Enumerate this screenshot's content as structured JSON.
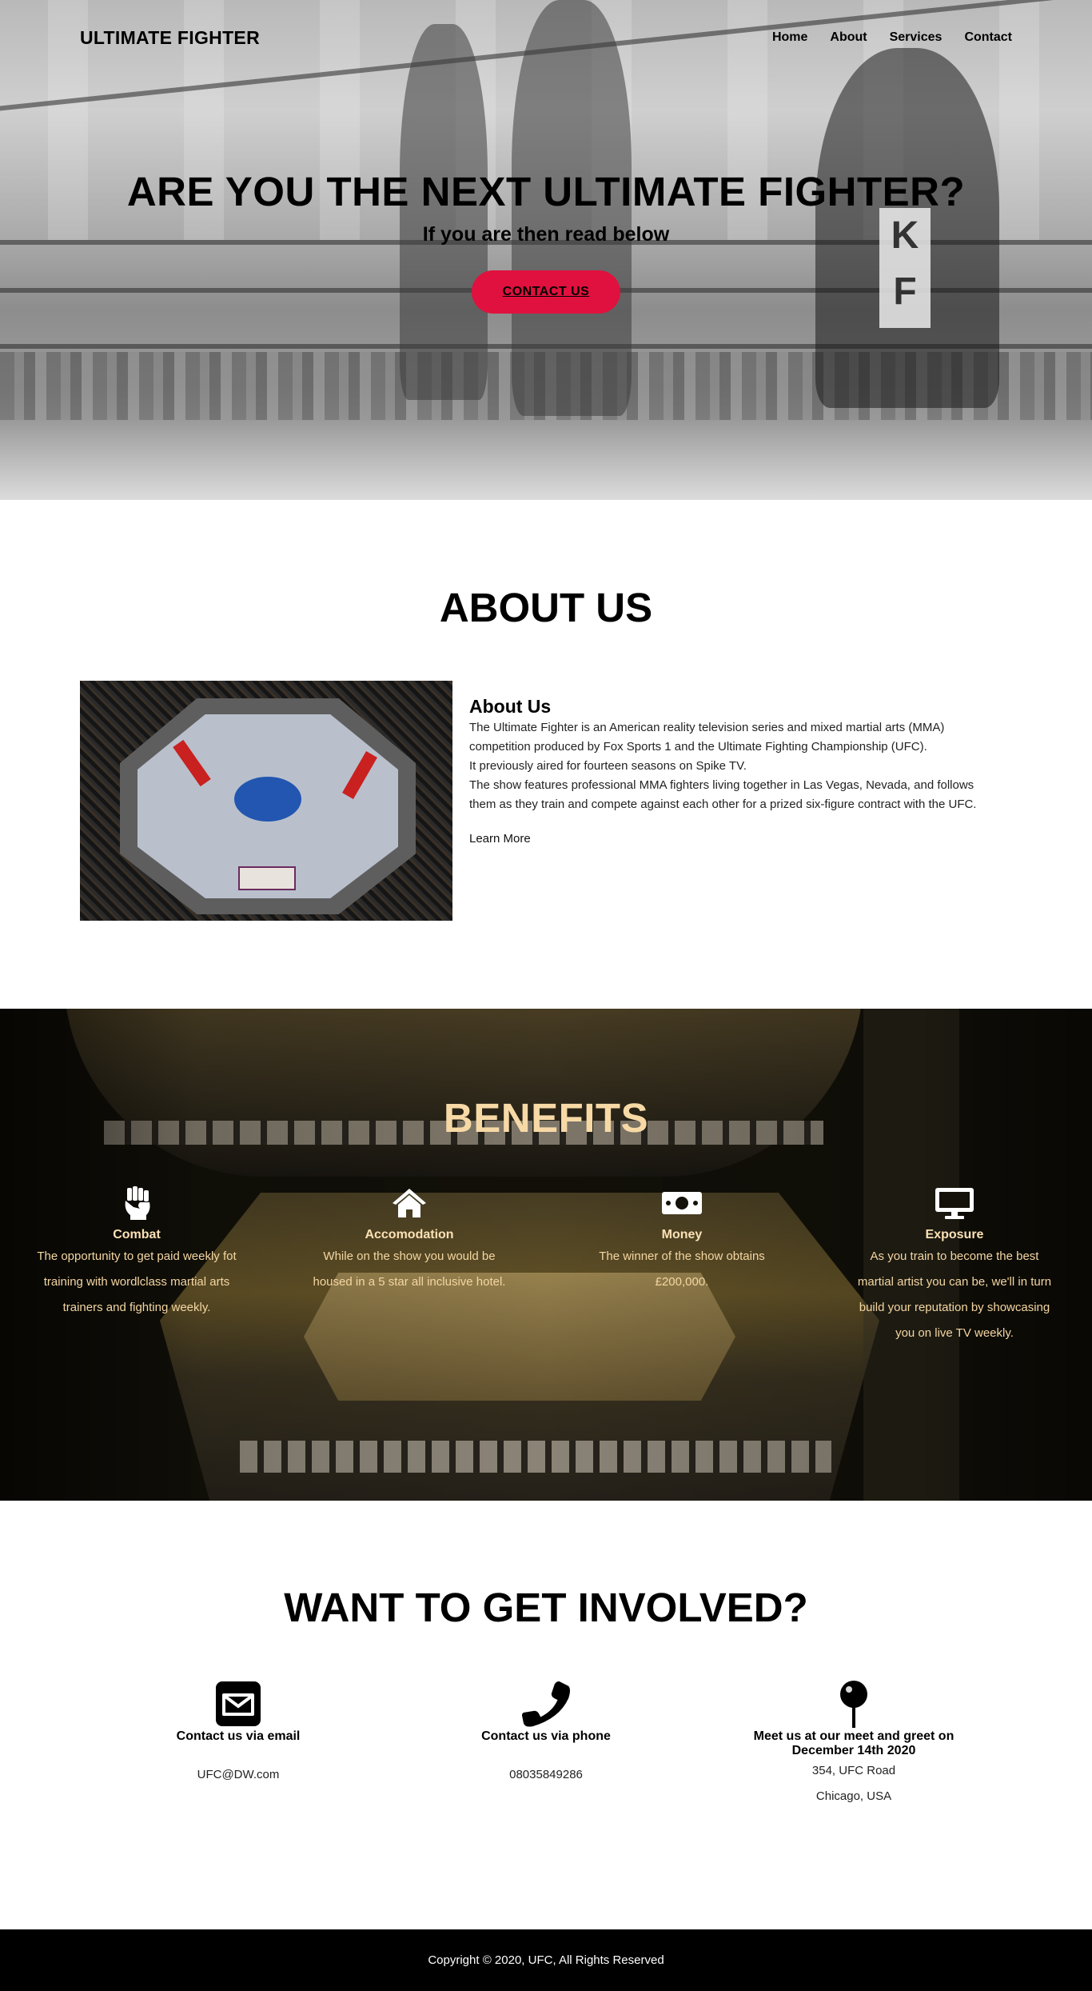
{
  "nav": {
    "brand": "ULTIMATE FIGHTER",
    "items": [
      "Home",
      "About",
      "Services",
      "Contact"
    ]
  },
  "hero": {
    "title": "ARE YOU THE NEXT ULTIMATE FIGHTER?",
    "subtitle": "If you are then read below",
    "cta_label": "CONTACT US",
    "cta_color": "#e0113e"
  },
  "about": {
    "section_title": "ABOUT US",
    "heading": "About Us",
    "paragraphs": [
      "The Ultimate Fighter is an American reality television series and mixed martial arts (MMA) competition produced by Fox Sports 1 and the Ultimate Fighting Championship (UFC).",
      "It previously aired for fourteen seasons on Spike TV.",
      "The show features professional MMA fighters living together in Las Vegas, Nevada, and follows them as they train and compete against each other for a prized six-figure contract with the UFC."
    ],
    "learn_more": "Learn More"
  },
  "benefits": {
    "title": "BENEFITS",
    "accent_color": "#f7d9a6",
    "items": [
      {
        "icon": "fist-icon",
        "name": "Combat",
        "desc": "The opportunity to get paid weekly fot training with wordlclass martial arts trainers and fighting weekly."
      },
      {
        "icon": "house-icon",
        "name": "Accomodation",
        "desc": "While on the show you would be housed in a 5 star all inclusive hotel."
      },
      {
        "icon": "money-icon",
        "name": "Money",
        "desc": "The winner of the show obtains £200,000."
      },
      {
        "icon": "monitor-icon",
        "name": "Exposure",
        "desc": "As you train to become the best martial artist you can be, we'll in turn build your reputation by showcasing you on live TV weekly."
      }
    ]
  },
  "contact": {
    "title": "WANT TO GET INVOLVED?",
    "items": [
      {
        "icon": "envelope-icon",
        "label": "Contact us via email",
        "value": "UFC@DW.com"
      },
      {
        "icon": "phone-icon",
        "label": "Contact us via phone",
        "value": "08035849286"
      },
      {
        "icon": "map-pin-icon",
        "label": "Meet us at our meet and greet on December 14th 2020",
        "value": "354, UFC Road",
        "value2": "Chicago, USA"
      }
    ]
  },
  "footer": {
    "text": "Copyright © 2020, UFC, All Rights Reserved"
  }
}
